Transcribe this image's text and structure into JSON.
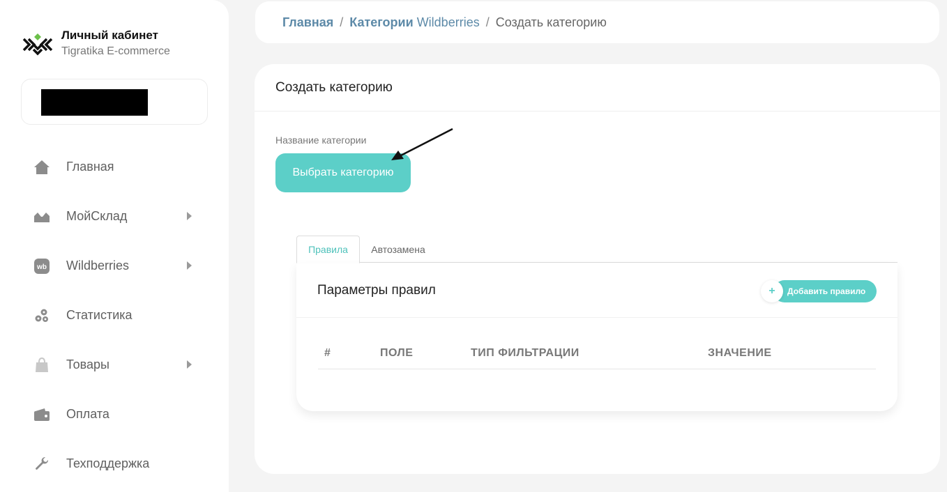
{
  "sidebar": {
    "brand_title": "Личный кабинет",
    "brand_sub": "Tigratika E-commerce",
    "items": [
      {
        "label": "Главная",
        "icon": "home-icon"
      },
      {
        "label": "МойСклад",
        "icon": "warehouse-icon",
        "has_arrow": true
      },
      {
        "label": "Wildberries",
        "icon": "wb-icon",
        "has_arrow": true
      },
      {
        "label": "Статистика",
        "icon": "cogs-icon"
      },
      {
        "label": "Товары",
        "icon": "bag-icon",
        "has_arrow": true
      },
      {
        "label": "Оплата",
        "icon": "wallet-icon"
      },
      {
        "label": "Техподдержка",
        "icon": "wrench-icon"
      }
    ]
  },
  "breadcrumb": {
    "home": "Главная",
    "categories": "Категории",
    "categories_suffix": "Wildberries",
    "current": "Создать категорию",
    "sep": "/"
  },
  "main": {
    "title": "Создать категорию",
    "field_label": "Название категории",
    "choose_button": "Выбрать категорию",
    "tabs": [
      "Правила",
      "Автозамена"
    ],
    "rules_title": "Параметры правил",
    "add_rule": "Добавить правило",
    "add_plus": "+",
    "columns": [
      "#",
      "ПОЛЕ",
      "ТИП ФИЛЬТРАЦИИ",
      "ЗНАЧЕНИЕ"
    ]
  },
  "colors": {
    "accent": "#5ccfc8",
    "link": "#5d8aa8",
    "background": "#f4f4f4"
  }
}
